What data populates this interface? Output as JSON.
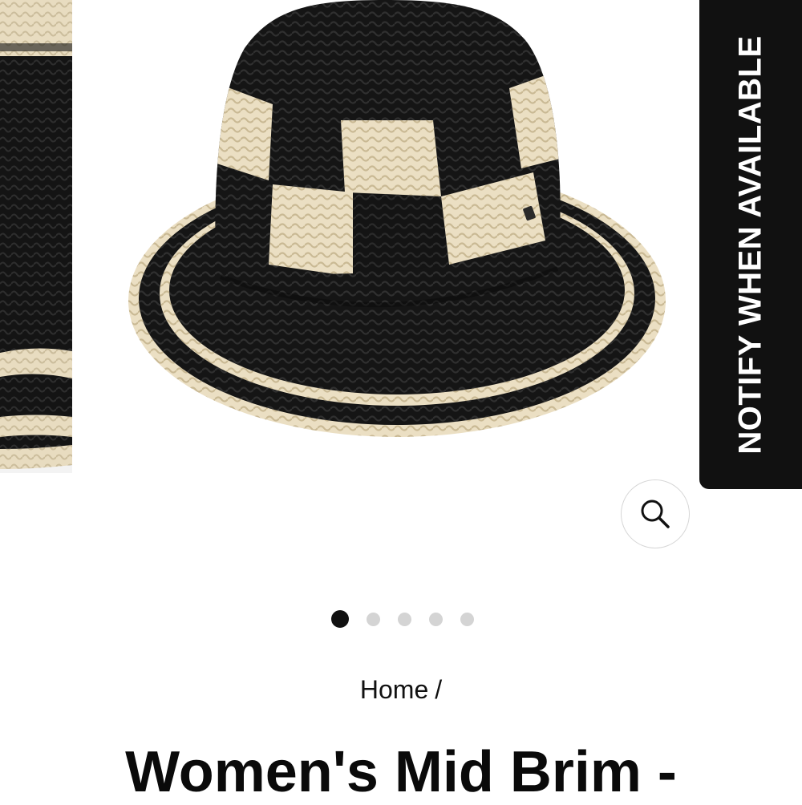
{
  "notify": {
    "label": "NOTIFY WHEN AVAILABLE"
  },
  "gallery": {
    "slide_count": 5,
    "active_index": 0,
    "zoom_icon": "magnifier-icon"
  },
  "breadcrumb": {
    "home": "Home",
    "separator": "/"
  },
  "product": {
    "title": "Women's Mid Brim -"
  },
  "colors": {
    "black_straw": "#141414",
    "cream_straw": "#e8dcc0",
    "accent": "#111111",
    "inactive_dot": "#d4d4d4"
  }
}
